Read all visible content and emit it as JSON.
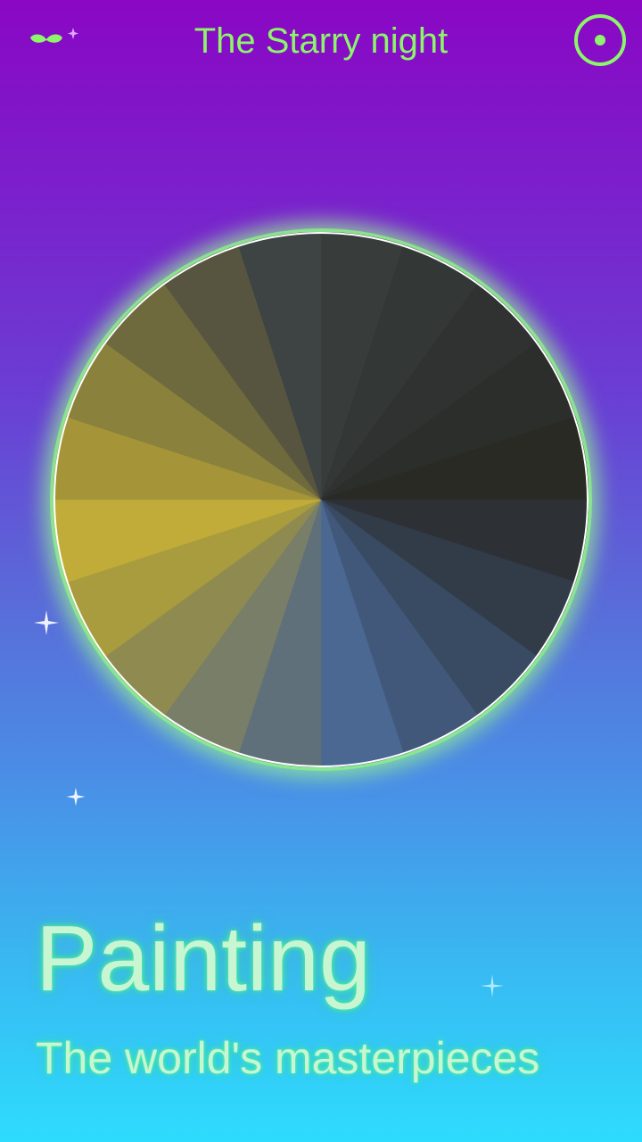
{
  "header": {
    "logo_icon": "mustache-icon",
    "title": "The Starry night",
    "action_icon": "target-circle-icon"
  },
  "hero": {
    "title": "Painting",
    "subtitle": "The world's masterpieces"
  },
  "palette_wheel": {
    "segment_count": 20,
    "colors": [
      "#383d3b",
      "#333735",
      "#2f3230",
      "#2c2e2b",
      "#2a2a25",
      "#2d3135",
      "#323c49",
      "#394b62",
      "#41587a",
      "#4a6891",
      "#5f707a",
      "#787e68",
      "#8f8a50",
      "#a89c3e",
      "#c1ac3a",
      "#a59538",
      "#8a813d",
      "#6f6a3d",
      "#57553f",
      "#3e4443"
    ]
  },
  "colors": {
    "accent_green": "#8cf56a",
    "glow_green": "#96f096",
    "gradient_top": "#8a07c4",
    "gradient_bottom": "#2edcfd"
  }
}
